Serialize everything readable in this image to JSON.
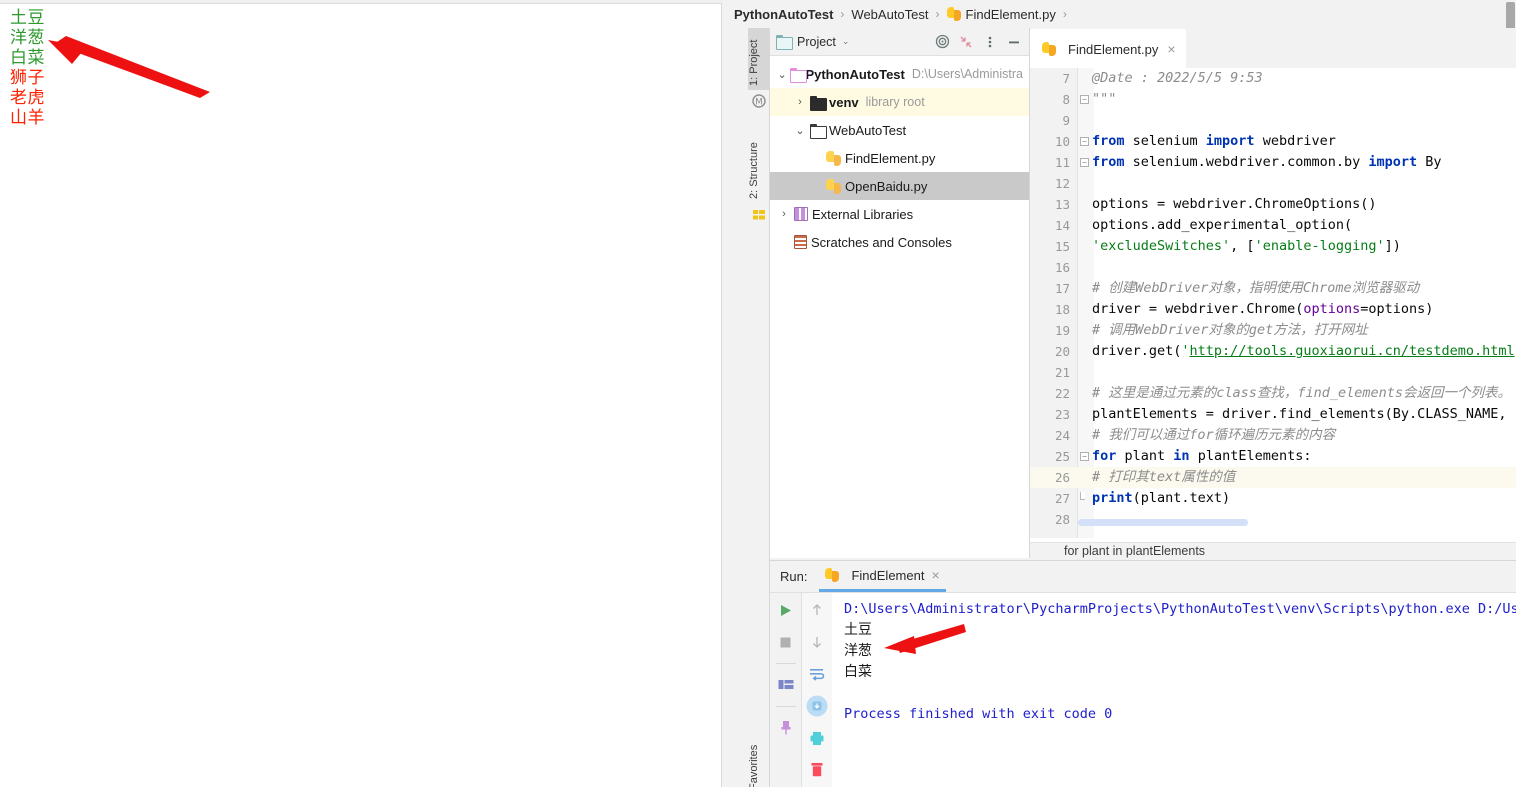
{
  "browser": {
    "plants": [
      {
        "text": "土豆",
        "color": "green"
      },
      {
        "text": "洋葱",
        "color": "green"
      },
      {
        "text": "白菜",
        "color": "green"
      },
      {
        "text": "狮子",
        "color": "red"
      },
      {
        "text": "老虎",
        "color": "red"
      },
      {
        "text": "山羊",
        "color": "red"
      }
    ],
    "annotation_arrow": "red-arrow-pointing-to-onion"
  },
  "ide": {
    "breadcrumb": {
      "items": [
        "PythonAutoTest",
        "WebAutoTest",
        "FindElement.py"
      ],
      "separator": "›"
    },
    "tool_strips": {
      "left": [
        "1: Project",
        "2: Structure",
        "Favorites"
      ]
    },
    "project_panel": {
      "title": "Project",
      "caret": "⌄",
      "buttons": [
        "target-icon",
        "collapse-all-icon",
        "options-icon",
        "hide-icon"
      ],
      "tree": [
        {
          "label": "PythonAutoTest",
          "hint": "D:\\Users\\Administra",
          "twisty": "⌄",
          "icon": "folder-pink",
          "bold": true,
          "indent": 0,
          "state": "normal"
        },
        {
          "label": "venv",
          "hint": "library root",
          "twisty": "›",
          "icon": "folder-black",
          "bold": true,
          "indent": 1,
          "state": "venv"
        },
        {
          "label": "WebAutoTest",
          "hint": "",
          "twisty": "⌄",
          "icon": "folder-plain",
          "bold": false,
          "indent": 1,
          "state": "normal"
        },
        {
          "label": "FindElement.py",
          "hint": "",
          "twisty": "",
          "icon": "python",
          "bold": false,
          "indent": 2,
          "state": "normal"
        },
        {
          "label": "OpenBaidu.py",
          "hint": "",
          "twisty": "",
          "icon": "python",
          "bold": false,
          "indent": 2,
          "state": "selected"
        },
        {
          "label": "External Libraries",
          "hint": "",
          "twisty": "›",
          "icon": "library",
          "bold": false,
          "indent": 0,
          "state": "normal"
        },
        {
          "label": "Scratches and Consoles",
          "hint": "",
          "twisty": "",
          "icon": "scratch",
          "bold": false,
          "indent": 0,
          "state": "normal"
        }
      ]
    },
    "editor": {
      "tab": {
        "label": "FindElement.py",
        "icon": "python-file-icon",
        "close": "×"
      },
      "bottom_breadcrumb": "for plant in plantElements",
      "lines": [
        {
          "num": "7",
          "fold": "",
          "highlight": false,
          "tokens": [
            {
              "t": "@Date     : 2022/5/5 9:53",
              "c": "cmt"
            }
          ]
        },
        {
          "num": "8",
          "fold": "minus",
          "highlight": false,
          "tokens": [
            {
              "t": "\"\"\"",
              "c": "cmt"
            }
          ]
        },
        {
          "num": "9",
          "fold": "",
          "highlight": false,
          "tokens": []
        },
        {
          "num": "10",
          "fold": "minus",
          "highlight": false,
          "tokens": [
            {
              "t": "from",
              "c": "kw"
            },
            {
              "t": " selenium ",
              "c": "plain"
            },
            {
              "t": "import",
              "c": "kw"
            },
            {
              "t": " webdriver",
              "c": "plain"
            }
          ]
        },
        {
          "num": "11",
          "fold": "minus",
          "highlight": false,
          "tokens": [
            {
              "t": "from",
              "c": "kw"
            },
            {
              "t": " selenium.webdriver.common.by ",
              "c": "plain"
            },
            {
              "t": "import",
              "c": "kw"
            },
            {
              "t": " By",
              "c": "plain"
            }
          ]
        },
        {
          "num": "12",
          "fold": "",
          "highlight": false,
          "tokens": []
        },
        {
          "num": "13",
          "fold": "",
          "highlight": false,
          "tokens": [
            {
              "t": "options = webdriver.ChromeOptions()",
              "c": "plain"
            }
          ]
        },
        {
          "num": "14",
          "fold": "",
          "highlight": false,
          "tokens": [
            {
              "t": "options.add_experimental_option(",
              "c": "plain"
            }
          ]
        },
        {
          "num": "15",
          "fold": "",
          "highlight": false,
          "tokens": [
            {
              "t": "    ",
              "c": "plain"
            },
            {
              "t": "'excludeSwitches'",
              "c": "str"
            },
            {
              "t": ", [",
              "c": "plain"
            },
            {
              "t": "'enable-logging'",
              "c": "str"
            },
            {
              "t": "])",
              "c": "plain"
            }
          ]
        },
        {
          "num": "16",
          "fold": "",
          "highlight": false,
          "tokens": []
        },
        {
          "num": "17",
          "fold": "",
          "highlight": false,
          "tokens": [
            {
              "t": "# 创建WebDriver对象，指明使用Chrome浏览器驱动",
              "c": "cmt"
            }
          ]
        },
        {
          "num": "18",
          "fold": "",
          "highlight": false,
          "tokens": [
            {
              "t": "driver = webdriver.Chrome(",
              "c": "plain"
            },
            {
              "t": "options",
              "c": "kwarg"
            },
            {
              "t": "=options)",
              "c": "plain"
            }
          ]
        },
        {
          "num": "19",
          "fold": "",
          "highlight": false,
          "tokens": [
            {
              "t": "# 调用WebDriver对象的get方法，打开网址",
              "c": "cmt"
            }
          ]
        },
        {
          "num": "20",
          "fold": "",
          "highlight": false,
          "tokens": [
            {
              "t": "driver.get(",
              "c": "plain"
            },
            {
              "t": "'",
              "c": "str"
            },
            {
              "t": "http://tools.guoxiaorui.cn/testdemo.html",
              "c": "link"
            },
            {
              "t": "'",
              "c": "str"
            }
          ]
        },
        {
          "num": "21",
          "fold": "",
          "highlight": false,
          "tokens": []
        },
        {
          "num": "22",
          "fold": "",
          "highlight": false,
          "tokens": [
            {
              "t": "# 这里是通过元素的class查找，find_elements会返回一个列表。",
              "c": "cmt"
            }
          ]
        },
        {
          "num": "23",
          "fold": "",
          "highlight": false,
          "tokens": [
            {
              "t": "plantElements = driver.find_elements(By.CLASS_NAME, ",
              "c": "plain"
            },
            {
              "t": "'",
              "c": "str"
            }
          ]
        },
        {
          "num": "24",
          "fold": "",
          "highlight": false,
          "tokens": [
            {
              "t": "# 我们可以通过for循环遍历元素的内容",
              "c": "cmt"
            }
          ]
        },
        {
          "num": "25",
          "fold": "minus",
          "highlight": false,
          "tokens": [
            {
              "t": "for",
              "c": "kw"
            },
            {
              "t": " plant ",
              "c": "plain"
            },
            {
              "t": "in",
              "c": "kw"
            },
            {
              "t": " plantElements:",
              "c": "plain"
            }
          ]
        },
        {
          "num": "26",
          "fold": "",
          "highlight": true,
          "tokens": [
            {
              "t": "    # 打印其text属性的值",
              "c": "cmt"
            }
          ]
        },
        {
          "num": "27",
          "fold": "corner",
          "highlight": false,
          "tokens": [
            {
              "t": "    ",
              "c": "plain"
            },
            {
              "t": "print",
              "c": "kw"
            },
            {
              "t": "(plant.text)",
              "c": "plain"
            }
          ]
        },
        {
          "num": "28",
          "fold": "",
          "highlight": false,
          "tokens": []
        }
      ]
    },
    "run_window": {
      "label": "Run:",
      "tab": {
        "label": "FindElement",
        "icon": "python-run-icon",
        "close": "×"
      },
      "left_toolbar_icons": [
        "run-icon",
        "stop-icon",
        "layout-icon",
        "pin-icon"
      ],
      "right_toolbar_icons": [
        "scroll-up-icon",
        "scroll-down-icon",
        "soft-wrap-icon",
        "scroll-to-end-icon",
        "print-icon",
        "trash-icon"
      ],
      "console_lines": [
        {
          "text": "D:\\Users\\Administrator\\PycharmProjects\\PythonAutoTest\\venv\\Scripts\\python.exe D:/User",
          "style": "path"
        },
        {
          "text": "土豆",
          "style": "cn"
        },
        {
          "text": "洋葱",
          "style": "cn"
        },
        {
          "text": "白菜",
          "style": "cn"
        },
        {
          "text": "",
          "style": "blank"
        },
        {
          "text": "Process finished with exit code 0",
          "style": "path"
        }
      ],
      "annotation_arrow": "red-arrow-pointing-to-onion-output"
    }
  },
  "colors": {
    "green_text": "#2e9a2e",
    "red_text": "#ff2200",
    "arrow_red": "#ee1111",
    "keyword_blue": "#0033b3",
    "string_green": "#067d17",
    "comment_gray": "#8c8c8c",
    "console_blue": "#2020cc",
    "selection_gray": "#c9c9c9",
    "venv_yellow": "#fffbe2"
  }
}
